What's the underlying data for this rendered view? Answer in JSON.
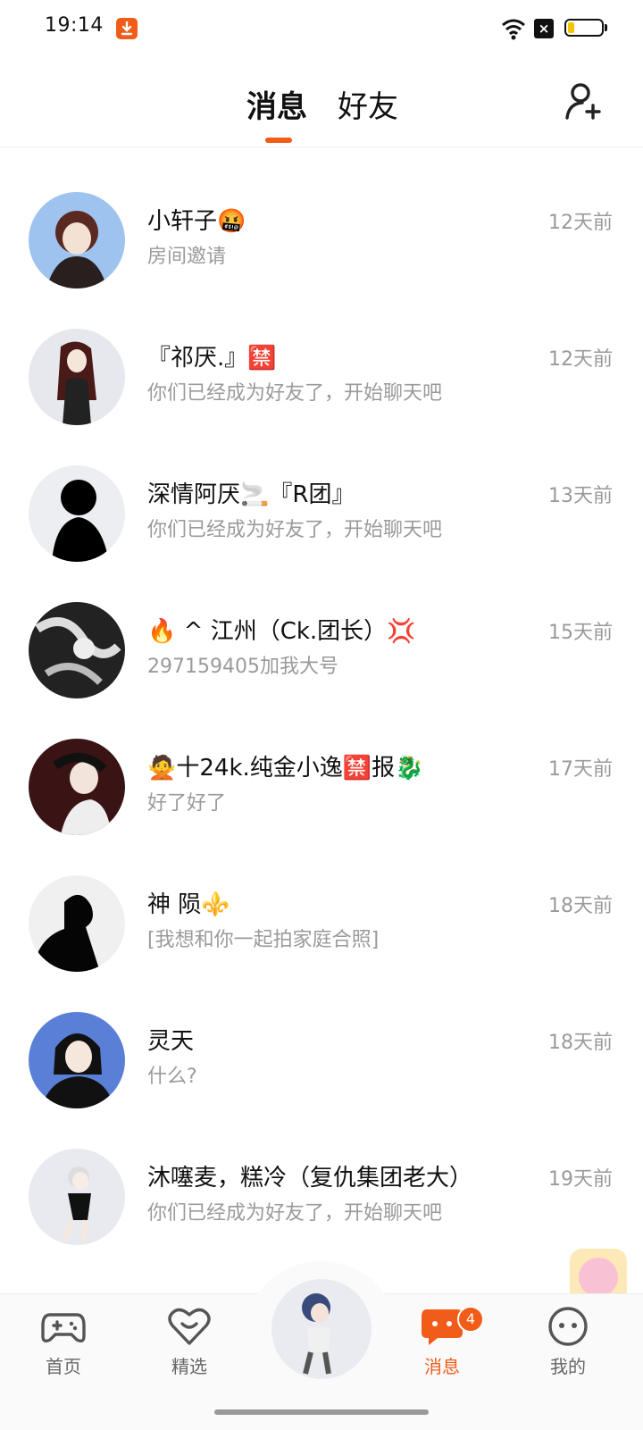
{
  "status_bar": {
    "time": "19:14",
    "icons": [
      "download-icon",
      "wifi-icon",
      "x-icon",
      "battery-icon"
    ],
    "battery_level": 0.2
  },
  "header": {
    "tabs": [
      "消息",
      "好友"
    ],
    "active_tab": "消息",
    "add_friend_icon": "add-user-icon"
  },
  "conversations": [
    {
      "name": "小轩子🤬",
      "message": "房间邀请",
      "time": "12天前"
    },
    {
      "name": "『祁厌.』🈲",
      "message": "你们已经成为好友了，开始聊天吧",
      "time": "12天前"
    },
    {
      "name": "深情阿厌🚬『R团』",
      "message": "你们已经成为好友了，开始聊天吧",
      "time": "13天前"
    },
    {
      "name": "🔥 ^ 江州（Ck.团长）💢",
      "message": "297159405加我大号",
      "time": "15天前"
    },
    {
      "name": "🙅十24k.纯金小逸🈲报🐉",
      "message": "好了好了",
      "time": "17天前"
    },
    {
      "name": "神  陨⚜️",
      "message": "[我想和你一起拍家庭合照]",
      "time": "18天前"
    },
    {
      "name": "灵天",
      "message": "什么?",
      "time": "18天前"
    },
    {
      "name": "沐噻麦，糕冷（复仇集团老大）",
      "message": "你们已经成为好友了，开始聊天吧",
      "time": "19天前"
    }
  ],
  "tabbar": {
    "items": [
      {
        "label": "首页",
        "icon": "gamepad-icon"
      },
      {
        "label": "精选",
        "icon": "heart-icon"
      },
      {
        "label": "消息",
        "icon": "chat-icon",
        "active": true,
        "badge": "4"
      },
      {
        "label": "我的",
        "icon": "face-icon"
      }
    ]
  },
  "colors": {
    "accent": "#f25c19",
    "secondary_text": "#9a9a9a"
  }
}
